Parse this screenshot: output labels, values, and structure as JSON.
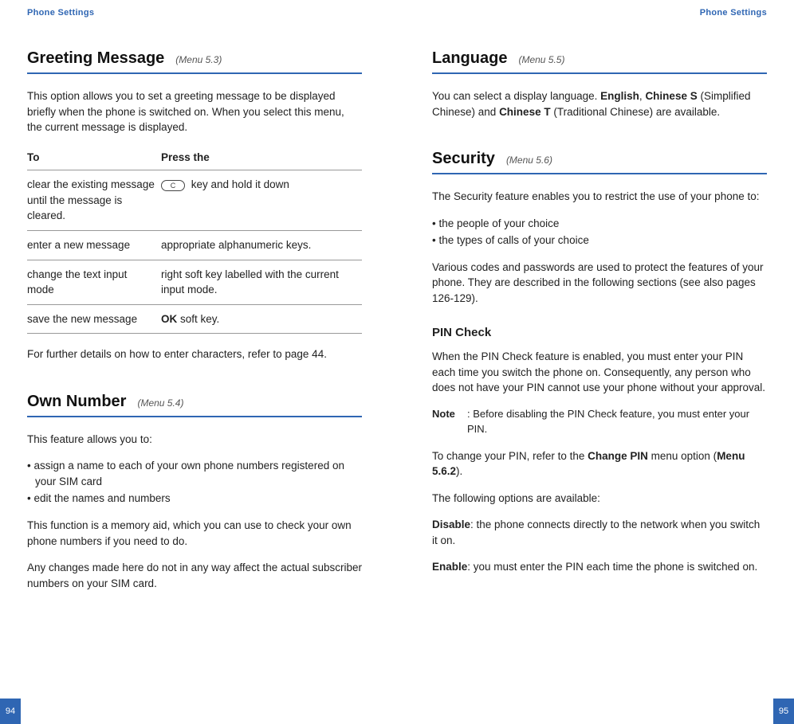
{
  "running_head": "Phone Settings",
  "left": {
    "page_number": "94",
    "sections": {
      "greeting": {
        "title": "Greeting Message",
        "menu": "(Menu 5.3)",
        "intro": "This option allows you to set a greeting message to be displayed briefly when the phone is switched on. When you select this menu, the current message is displayed.",
        "table": {
          "head_to": "To",
          "head_press": "Press the",
          "rows": [
            {
              "to": "clear the existing message",
              "press_pre_icon": true,
              "press": "key and hold it down",
              "extra": "until the message is cleared."
            },
            {
              "to": "enter a new message",
              "press": "appropriate alphanumeric keys."
            },
            {
              "to": "change the text input mode",
              "press": "right soft key labelled with the current input mode."
            },
            {
              "to": "save the new message",
              "press_bold": "OK",
              "press_after": " soft key."
            }
          ],
          "icon_label": "C"
        },
        "footer": "For further details on how to enter characters, refer to page 44."
      },
      "own_number": {
        "title": "Own Number",
        "menu": "(Menu 5.4)",
        "intro": "This feature allows you to:",
        "bullets": [
          "assign a name to each of your own phone numbers registered on your SIM card",
          "edit the names and numbers"
        ],
        "para2": "This function is a memory aid, which you can use to check your own phone numbers if you need to do.",
        "para3": "Any changes made here do not in any way affect the actual subscriber numbers on your SIM card."
      }
    }
  },
  "right": {
    "page_number": "95",
    "sections": {
      "language": {
        "title": "Language",
        "menu": "(Menu 5.5)",
        "para_pre": "You can select a display language. ",
        "english": "English",
        "mid1": ", ",
        "chinese_s": "Chinese S",
        "mid2": " (Simplified Chinese) and ",
        "chinese_t": "Chinese T",
        "mid3": " (Traditional Chinese) are available."
      },
      "security": {
        "title": "Security",
        "menu": "(Menu 5.6)",
        "intro": "The Security feature enables you to restrict the use of your phone to:",
        "bullets": [
          "the people of your choice",
          "the types of calls of your choice"
        ],
        "para2": "Various codes and passwords are used to protect the features of your phone. They are described in the following sections (see also pages 126-129).",
        "pin_check": {
          "heading": "PIN Check",
          "para1": "When the PIN Check feature is enabled, you must enter your PIN each time you switch the phone on. Consequently, any person who does not have your PIN cannot use your phone without your approval.",
          "note_label": "Note",
          "note_text": ": Before disabling the PIN Check feature, you must enter your PIN.",
          "para2_pre": "To change your PIN, refer to the ",
          "para2_bold1": "Change PIN",
          "para2_mid": " menu option (",
          "para2_bold2": "Menu 5.6.2",
          "para2_post": ").",
          "options_intro": "The following options are available:",
          "disable_label": "Disable",
          "disable_text": ": the phone connects directly to the network when you switch it on.",
          "enable_label": "Enable",
          "enable_text": ": you must enter the PIN each time the phone is switched on."
        }
      }
    }
  }
}
